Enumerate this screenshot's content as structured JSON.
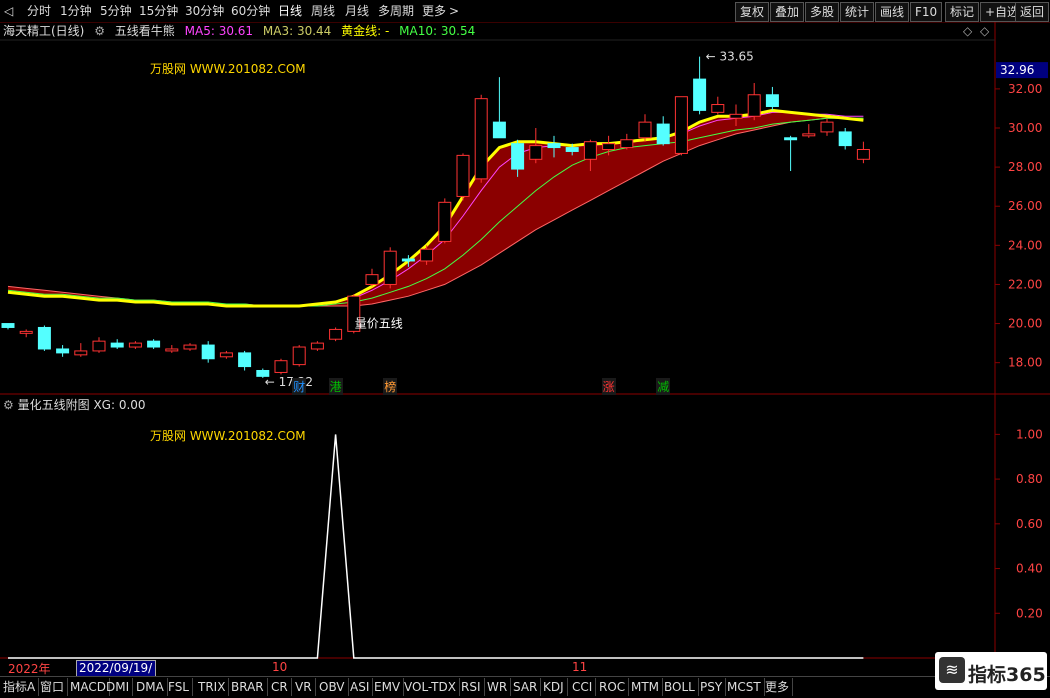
{
  "toolbar": {
    "left": [
      {
        "label": "分时",
        "x": 27
      },
      {
        "label": "1分钟",
        "x": 60
      },
      {
        "label": "5分钟",
        "x": 100
      },
      {
        "label": "15分钟",
        "x": 139
      },
      {
        "label": "30分钟",
        "x": 185
      },
      {
        "label": "60分钟",
        "x": 231
      },
      {
        "label": "日线",
        "x": 278,
        "selected": true
      },
      {
        "label": "周线",
        "x": 311
      },
      {
        "label": "月线",
        "x": 345
      },
      {
        "label": "多周期",
        "x": 378
      },
      {
        "label": "更多",
        "x": 422
      }
    ],
    "more_arrow": ">",
    "right": [
      {
        "label": "复权",
        "x": 735
      },
      {
        "label": "叠加",
        "x": 770
      },
      {
        "label": "多股",
        "x": 805
      },
      {
        "label": "统计",
        "x": 840
      },
      {
        "label": "画线",
        "x": 875
      },
      {
        "label": "F10",
        "x": 910
      },
      {
        "label": "标记",
        "x": 945
      },
      {
        "label": "+自选",
        "x": 980
      },
      {
        "label": "返回",
        "x": 1015
      }
    ]
  },
  "main_info": {
    "stock": "海天精工(日线)",
    "indicator": "五线看牛熊",
    "ma5_label": "MA5: 30.61",
    "ma3_label": "MA3: 30.44",
    "gold_label": "黄金线: -",
    "ma10_label": "MA10: 30.54"
  },
  "sub_info": {
    "title": "量化五线附图",
    "xg": "XG: 0.00"
  },
  "watermark": "万股网 WWW.201082.COM",
  "annotations": {
    "high": "33.65",
    "low": "17.22",
    "signal": "量价五线"
  },
  "events": [
    {
      "label": "财",
      "idx": 16,
      "color": "#1e90ff"
    },
    {
      "label": "港",
      "idx": 18,
      "color": "#00c000"
    },
    {
      "label": "榜",
      "idx": 21,
      "color": "#ff9933"
    },
    {
      "label": "涨",
      "idx": 33,
      "color": "#ff3333"
    },
    {
      "label": "减",
      "idx": 36,
      "color": "#00c000"
    }
  ],
  "price_tag": "32.96",
  "date_axis": {
    "year": "2022年",
    "cursor": "2022/09/19/—",
    "m10": "10",
    "m11": "11"
  },
  "bottom_tabs": [
    "指标A",
    "窗口",
    "MACD",
    "DMI",
    "DMA",
    "FSL",
    "TRIX",
    "BRAR",
    "CR",
    "VR",
    "OBV",
    "ASI",
    "EMV",
    "VOL-TDX",
    "RSI",
    "WR",
    "SAR",
    "KDJ",
    "CCI",
    "ROC",
    "MTM",
    "BOLL",
    "PSY",
    "MCST",
    "更多"
  ],
  "colors": {
    "up": "#ff3333",
    "down": "#54ffff",
    "fill": "#8b0000",
    "gold": "#ffff00",
    "ma5": "#ff44ff",
    "ma10": "#44ff44",
    "grid": "#8b0000"
  },
  "logo_text": "指标365",
  "chart_data": [
    {
      "type": "candlestick",
      "ylim": [
        16.5,
        34.5
      ],
      "yticks": [
        18,
        20,
        22,
        24,
        26,
        28,
        30,
        32
      ],
      "candles": [
        {
          "o": 20.0,
          "h": 20.0,
          "l": 19.7,
          "c": 19.8
        },
        {
          "o": 19.5,
          "h": 19.7,
          "l": 19.3,
          "c": 19.6
        },
        {
          "o": 19.8,
          "h": 19.9,
          "l": 18.6,
          "c": 18.7
        },
        {
          "o": 18.7,
          "h": 18.9,
          "l": 18.3,
          "c": 18.5
        },
        {
          "o": 18.4,
          "h": 19.0,
          "l": 18.3,
          "c": 18.6
        },
        {
          "o": 18.6,
          "h": 19.3,
          "l": 18.5,
          "c": 19.1
        },
        {
          "o": 19.0,
          "h": 19.2,
          "l": 18.7,
          "c": 18.8
        },
        {
          "o": 18.8,
          "h": 19.1,
          "l": 18.7,
          "c": 19.0
        },
        {
          "o": 19.1,
          "h": 19.2,
          "l": 18.7,
          "c": 18.8
        },
        {
          "o": 18.6,
          "h": 18.9,
          "l": 18.5,
          "c": 18.7
        },
        {
          "o": 18.7,
          "h": 19.0,
          "l": 18.6,
          "c": 18.9
        },
        {
          "o": 18.9,
          "h": 19.1,
          "l": 18.0,
          "c": 18.2
        },
        {
          "o": 18.3,
          "h": 18.6,
          "l": 18.2,
          "c": 18.5
        },
        {
          "o": 18.5,
          "h": 18.6,
          "l": 17.6,
          "c": 17.8
        },
        {
          "o": 17.6,
          "h": 17.7,
          "l": 17.22,
          "c": 17.3
        },
        {
          "o": 17.5,
          "h": 18.2,
          "l": 17.4,
          "c": 18.1
        },
        {
          "o": 17.9,
          "h": 18.9,
          "l": 17.8,
          "c": 18.8
        },
        {
          "o": 18.7,
          "h": 19.1,
          "l": 18.6,
          "c": 19.0
        },
        {
          "o": 19.2,
          "h": 19.8,
          "l": 19.1,
          "c": 19.7
        },
        {
          "o": 19.6,
          "h": 21.5,
          "l": 19.5,
          "c": 21.4
        },
        {
          "o": 22.0,
          "h": 22.8,
          "l": 21.9,
          "c": 22.5
        },
        {
          "o": 22.0,
          "h": 23.9,
          "l": 21.8,
          "c": 23.7
        },
        {
          "o": 23.3,
          "h": 23.5,
          "l": 22.9,
          "c": 23.2
        },
        {
          "o": 23.2,
          "h": 24.0,
          "l": 23.0,
          "c": 23.8
        },
        {
          "o": 24.2,
          "h": 26.4,
          "l": 24.1,
          "c": 26.2
        },
        {
          "o": 26.5,
          "h": 28.7,
          "l": 26.3,
          "c": 28.6
        },
        {
          "o": 27.4,
          "h": 31.7,
          "l": 27.2,
          "c": 31.5
        },
        {
          "o": 30.3,
          "h": 32.6,
          "l": 29.6,
          "c": 29.5
        },
        {
          "o": 29.2,
          "h": 29.4,
          "l": 27.5,
          "c": 27.9
        },
        {
          "o": 28.4,
          "h": 30.0,
          "l": 28.2,
          "c": 29.1
        },
        {
          "o": 29.2,
          "h": 29.6,
          "l": 28.5,
          "c": 29.0
        },
        {
          "o": 29.0,
          "h": 29.2,
          "l": 28.6,
          "c": 28.8
        },
        {
          "o": 28.4,
          "h": 29.4,
          "l": 27.8,
          "c": 29.3
        },
        {
          "o": 28.9,
          "h": 29.6,
          "l": 28.6,
          "c": 29.2
        },
        {
          "o": 29.0,
          "h": 29.7,
          "l": 28.9,
          "c": 29.4
        },
        {
          "o": 29.5,
          "h": 30.7,
          "l": 29.3,
          "c": 30.3
        },
        {
          "o": 30.2,
          "h": 30.6,
          "l": 29.1,
          "c": 29.2
        },
        {
          "o": 28.7,
          "h": 31.6,
          "l": 28.6,
          "c": 31.6
        },
        {
          "o": 32.5,
          "h": 33.65,
          "l": 30.7,
          "c": 30.9
        },
        {
          "o": 30.8,
          "h": 31.6,
          "l": 30.7,
          "c": 31.2
        },
        {
          "o": 30.5,
          "h": 31.2,
          "l": 30.1,
          "c": 30.7
        },
        {
          "o": 30.6,
          "h": 32.3,
          "l": 30.4,
          "c": 31.7
        },
        {
          "o": 31.7,
          "h": 32.1,
          "l": 30.9,
          "c": 31.1
        },
        {
          "o": 29.5,
          "h": 29.6,
          "l": 27.8,
          "c": 29.4
        },
        {
          "o": 29.6,
          "h": 30.2,
          "l": 29.5,
          "c": 29.7
        },
        {
          "o": 29.8,
          "h": 30.5,
          "l": 29.6,
          "c": 30.3
        },
        {
          "o": 29.8,
          "h": 30.0,
          "l": 28.9,
          "c": 29.1
        },
        {
          "o": 28.4,
          "h": 29.3,
          "l": 28.2,
          "c": 28.9
        }
      ],
      "line_ma_slow": [
        21.9,
        21.8,
        21.7,
        21.6,
        21.5,
        21.4,
        21.3,
        21.2,
        21.2,
        21.1,
        21.1,
        21.0,
        21.0,
        21.0,
        20.9,
        20.9,
        20.9,
        20.9,
        20.9,
        20.9,
        21.0,
        21.2,
        21.4,
        21.7,
        22.0,
        22.5,
        23.0,
        23.6,
        24.2,
        24.8,
        25.3,
        25.8,
        26.3,
        26.8,
        27.3,
        27.8,
        28.3,
        28.7,
        29.1,
        29.4,
        29.7,
        29.9,
        30.1,
        30.3,
        30.4,
        30.5,
        30.5,
        30.5
      ],
      "line_gold": [
        21.6,
        21.5,
        21.4,
        21.4,
        21.3,
        21.2,
        21.2,
        21.1,
        21.1,
        21.0,
        21.0,
        21.0,
        20.9,
        20.9,
        20.9,
        20.9,
        20.9,
        21.0,
        21.1,
        21.4,
        21.9,
        22.5,
        23.2,
        24.0,
        25.0,
        26.5,
        28.0,
        29.0,
        29.3,
        29.3,
        29.2,
        29.1,
        29.2,
        29.2,
        29.3,
        29.4,
        29.5,
        29.8,
        30.3,
        30.6,
        30.6,
        30.7,
        30.9,
        30.8,
        30.7,
        30.6,
        30.5,
        30.4
      ],
      "line_ma5": [
        21.6,
        21.5,
        21.4,
        21.4,
        21.3,
        21.2,
        21.2,
        21.1,
        21.1,
        21.0,
        21.0,
        21.0,
        20.9,
        20.9,
        20.9,
        20.9,
        20.9,
        21.0,
        21.1,
        21.3,
        21.7,
        22.2,
        22.8,
        23.5,
        24.3,
        25.5,
        26.8,
        28.0,
        28.7,
        29.0,
        29.1,
        29.1,
        29.1,
        29.2,
        29.3,
        29.4,
        29.5,
        29.7,
        30.1,
        30.4,
        30.5,
        30.6,
        30.8,
        30.8,
        30.7,
        30.7,
        30.6,
        30.6
      ],
      "line_ma10": [
        21.7,
        21.6,
        21.5,
        21.5,
        21.4,
        21.3,
        21.3,
        21.2,
        21.2,
        21.1,
        21.1,
        21.1,
        21.0,
        21.0,
        20.9,
        20.9,
        20.9,
        20.9,
        21.0,
        21.1,
        21.3,
        21.6,
        21.9,
        22.3,
        22.8,
        23.5,
        24.3,
        25.2,
        26.0,
        26.8,
        27.5,
        28.1,
        28.5,
        28.8,
        29.0,
        29.1,
        29.2,
        29.3,
        29.5,
        29.7,
        29.9,
        30.0,
        30.2,
        30.3,
        30.4,
        30.5,
        30.5,
        30.5
      ]
    },
    {
      "type": "line",
      "ylim": [
        0,
        1.1
      ],
      "yticks": [
        0.2,
        0.4,
        0.6,
        0.8,
        1.0
      ],
      "ytick_labels": [
        "0.20",
        "0.40",
        "0.60",
        "0.80",
        "1.00"
      ],
      "spike_index": 18,
      "values": [
        0,
        0,
        0,
        0,
        0,
        0,
        0,
        0,
        0,
        0,
        0,
        0,
        0,
        0,
        0,
        0,
        0,
        0,
        1,
        0,
        0,
        0,
        0,
        0,
        0,
        0,
        0,
        0,
        0,
        0,
        0,
        0,
        0,
        0,
        0,
        0,
        0,
        0,
        0,
        0,
        0,
        0,
        0,
        0,
        0,
        0,
        0,
        0
      ]
    }
  ]
}
